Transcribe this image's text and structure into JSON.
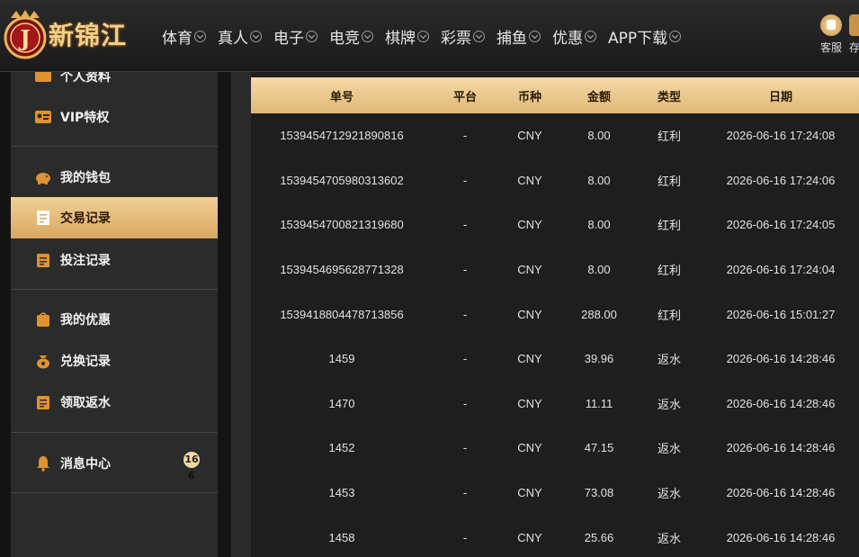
{
  "brand": {
    "name": "新锦江",
    "badge_letter": "J"
  },
  "nav": [
    {
      "label": "体育"
    },
    {
      "label": "真人"
    },
    {
      "label": "电子"
    },
    {
      "label": "电竞"
    },
    {
      "label": "棋牌"
    },
    {
      "label": "彩票"
    },
    {
      "label": "捕鱼"
    },
    {
      "label": "优惠"
    },
    {
      "label": "APP下载"
    }
  ],
  "header_actions": {
    "service_label": "客服",
    "deposit_label": "存"
  },
  "sidebar": {
    "partial_top_label": "个人资料",
    "items": [
      {
        "label": "VIP特权",
        "icon": "vip-card-icon"
      },
      {
        "label": "我的钱包",
        "icon": "piggy-bank-icon"
      },
      {
        "label": "交易记录",
        "icon": "document-icon",
        "active": true
      },
      {
        "label": "投注记录",
        "icon": "notes-icon"
      },
      {
        "label": "我的优惠",
        "icon": "gift-bag-icon"
      },
      {
        "label": "兑换记录",
        "icon": "money-bag-icon"
      },
      {
        "label": "领取返水",
        "icon": "notes-icon"
      },
      {
        "label": "消息中心",
        "icon": "bell-icon"
      }
    ],
    "message_badge": "16",
    "message_badge_sub": "6"
  },
  "table": {
    "headers": [
      "单号",
      "平台",
      "币种",
      "金额",
      "类型",
      "日期"
    ],
    "rows": [
      [
        "1539454712921890816",
        "-",
        "CNY",
        "8.00",
        "红利",
        "2026-06-16 17:24:08"
      ],
      [
        "1539454705980313602",
        "-",
        "CNY",
        "8.00",
        "红利",
        "2026-06-16 17:24:06"
      ],
      [
        "1539454700821319680",
        "-",
        "CNY",
        "8.00",
        "红利",
        "2026-06-16 17:24:05"
      ],
      [
        "1539454695628771328",
        "-",
        "CNY",
        "8.00",
        "红利",
        "2026-06-16 17:24:04"
      ],
      [
        "1539418804478713856",
        "-",
        "CNY",
        "288.00",
        "红利",
        "2026-06-16 15:01:27"
      ],
      [
        "1459",
        "-",
        "CNY",
        "39.96",
        "返水",
        "2026-06-16 14:28:46"
      ],
      [
        "1470",
        "-",
        "CNY",
        "11.11",
        "返水",
        "2026-06-16 14:28:46"
      ],
      [
        "1452",
        "-",
        "CNY",
        "47.15",
        "返水",
        "2026-06-16 14:28:46"
      ],
      [
        "1453",
        "-",
        "CNY",
        "73.08",
        "返水",
        "2026-06-16 14:28:46"
      ],
      [
        "1458",
        "-",
        "CNY",
        "25.66",
        "返水",
        "2026-06-16 14:28:46"
      ]
    ]
  },
  "colors": {
    "accent_gold": "#e1b878",
    "active_item": "#d9a862",
    "icon_orange": "#e0922f"
  }
}
